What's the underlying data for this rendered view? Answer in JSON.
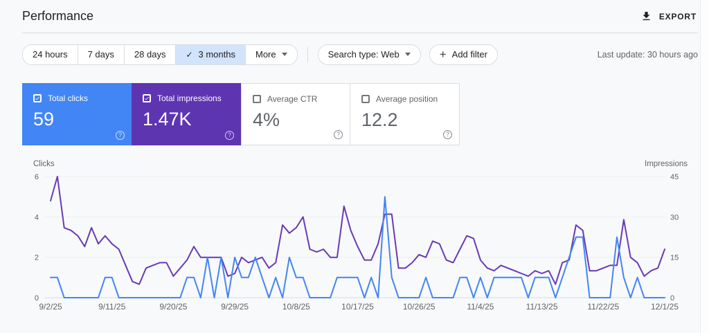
{
  "header": {
    "title": "Performance",
    "export_label": "EXPORT"
  },
  "toolbar": {
    "date_chips": [
      {
        "label": "24 hours",
        "selected": false,
        "caret": false
      },
      {
        "label": "7 days",
        "selected": false,
        "caret": false
      },
      {
        "label": "28 days",
        "selected": false,
        "caret": false
      },
      {
        "label": "3 months",
        "selected": true,
        "caret": false
      },
      {
        "label": "More",
        "selected": false,
        "caret": true
      }
    ],
    "selected_check": "✓",
    "search_type_label": "Search type: Web",
    "add_filter_label": "Add filter",
    "last_update": "Last update: 30 hours ago"
  },
  "metric_cards": [
    {
      "label": "Total clicks",
      "value": "59",
      "selected": true,
      "color": "#4285f4"
    },
    {
      "label": "Total impressions",
      "value": "1.47K",
      "selected": true,
      "color": "#5e35b1"
    },
    {
      "label": "Average CTR",
      "value": "4%",
      "selected": false,
      "color": "#ffffff"
    },
    {
      "label": "Average position",
      "value": "12.2",
      "selected": false,
      "color": "#ffffff"
    }
  ],
  "chart_data": {
    "type": "line",
    "title": "",
    "grid": true,
    "left_axis": {
      "label": "Clicks",
      "ticks": [
        0,
        2,
        4,
        6
      ],
      "max": 6
    },
    "right_axis": {
      "label": "Impressions",
      "ticks": [
        0,
        15,
        30,
        45
      ],
      "max": 45
    },
    "x_tick_labels": [
      "9/2/25",
      "9/11/25",
      "9/20/25",
      "9/29/25",
      "10/8/25",
      "10/17/25",
      "10/26/25",
      "11/4/25",
      "11/13/25",
      "11/22/25",
      "12/1/25"
    ],
    "x_tick_days": [
      0,
      9,
      18,
      27,
      36,
      45,
      54,
      63,
      72,
      81,
      90
    ],
    "days_total": 90,
    "series": [
      {
        "name": "Impressions",
        "axis": "right",
        "color": "#673ab7",
        "values": [
          36,
          45,
          26,
          25,
          23,
          19,
          26,
          20,
          23,
          20,
          18,
          12,
          6,
          5,
          11,
          12,
          13,
          13,
          8,
          11,
          14,
          19,
          15,
          15,
          15,
          15,
          8,
          9,
          15,
          13,
          14,
          15,
          11,
          13,
          27,
          24,
          26,
          30,
          18,
          17,
          18,
          15,
          15,
          34,
          25,
          19,
          14,
          14,
          20,
          31,
          31,
          11,
          11,
          13,
          16,
          15,
          21,
          20,
          14,
          13,
          18,
          23,
          22,
          14,
          11,
          10,
          12,
          11,
          10,
          9,
          8,
          10,
          9,
          10,
          5,
          13,
          14,
          27,
          25,
          10,
          10,
          11,
          12,
          12,
          29,
          15,
          13,
          8,
          10,
          11,
          18
        ]
      },
      {
        "name": "Clicks",
        "axis": "left",
        "color": "#4285f4",
        "values": [
          1,
          1,
          0,
          0,
          0,
          0,
          0,
          0,
          1,
          1,
          0,
          0,
          0,
          0,
          0,
          0,
          0,
          0,
          0,
          0,
          1,
          1,
          0,
          2,
          0,
          2,
          0,
          2,
          1,
          1,
          2,
          1,
          0,
          1,
          0,
          2,
          1,
          1,
          0,
          0,
          0,
          0,
          1,
          1,
          1,
          1,
          0,
          1,
          0,
          5,
          1,
          0,
          0,
          0,
          0,
          1,
          0,
          0,
          0,
          0,
          1,
          1,
          0,
          1,
          0,
          1,
          1,
          1,
          1,
          1,
          0,
          1,
          1,
          1,
          0,
          1,
          2,
          3,
          3,
          0,
          0,
          0,
          0,
          3,
          1,
          0,
          1,
          0,
          0,
          0,
          0
        ]
      }
    ]
  }
}
